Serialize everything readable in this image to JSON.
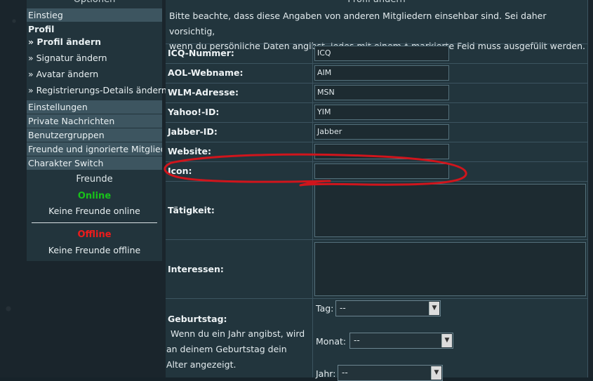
{
  "sidebar": {
    "title": "Optionen",
    "items": [
      {
        "label": "Einstieg"
      },
      {
        "label": "Profil"
      }
    ],
    "subitems": [
      {
        "label": "» Profil ändern"
      },
      {
        "label": "» Signatur ändern"
      },
      {
        "label": "» Avatar ändern"
      },
      {
        "label": "» Registrierungs-Details ändern"
      }
    ],
    "sections": [
      {
        "label": "Einstellungen"
      },
      {
        "label": "Private Nachrichten"
      },
      {
        "label": "Benutzergruppen"
      },
      {
        "label": "Freunde und ignorierte Mitglieder"
      },
      {
        "label": "Charakter Switch"
      }
    ],
    "friends": {
      "title": "Freunde",
      "online_label": "Online",
      "online_text": "Keine Freunde online",
      "offline_label": "Offline",
      "offline_text": "Keine Freunde offline"
    }
  },
  "main": {
    "title": "Profil ändern",
    "notice_line1": "Bitte beachte, dass diese Angaben von anderen Mitgliedern einsehbar sind. Sei daher vorsichtig,",
    "notice_line2": "wenn du persönliche Daten angibst. Jedes mit einem * markierte Feld muss ausgefüllt werden.",
    "fields": [
      {
        "label": "ICQ-Nummer:",
        "value": "ICQ"
      },
      {
        "label": "AOL-Webname:",
        "value": "AIM"
      },
      {
        "label": "WLM-Adresse:",
        "value": "MSN"
      },
      {
        "label": "Yahoo!-ID:",
        "value": "YIM"
      },
      {
        "label": "Jabber-ID:",
        "value": "Jabber"
      },
      {
        "label": "Website:",
        "value": ""
      },
      {
        "label": "Icon:",
        "value": ""
      }
    ],
    "occupation_label": "Tätigkeit:",
    "interests_label": "Interessen:",
    "birthday": {
      "label": "Geburtstag:",
      "description": "Wenn du ein Jahr angibst, wird an deinem Geburtstag dein Alter angezeigt.",
      "day_label": "Tag:",
      "day_value": "--",
      "month_label": "Monat:",
      "month_value": "--",
      "year_label": "Jahr:",
      "year_value": "--"
    }
  },
  "colors": {
    "online": "#18c21a",
    "offline": "#ee1c1c",
    "annotation": "#d0151c"
  }
}
